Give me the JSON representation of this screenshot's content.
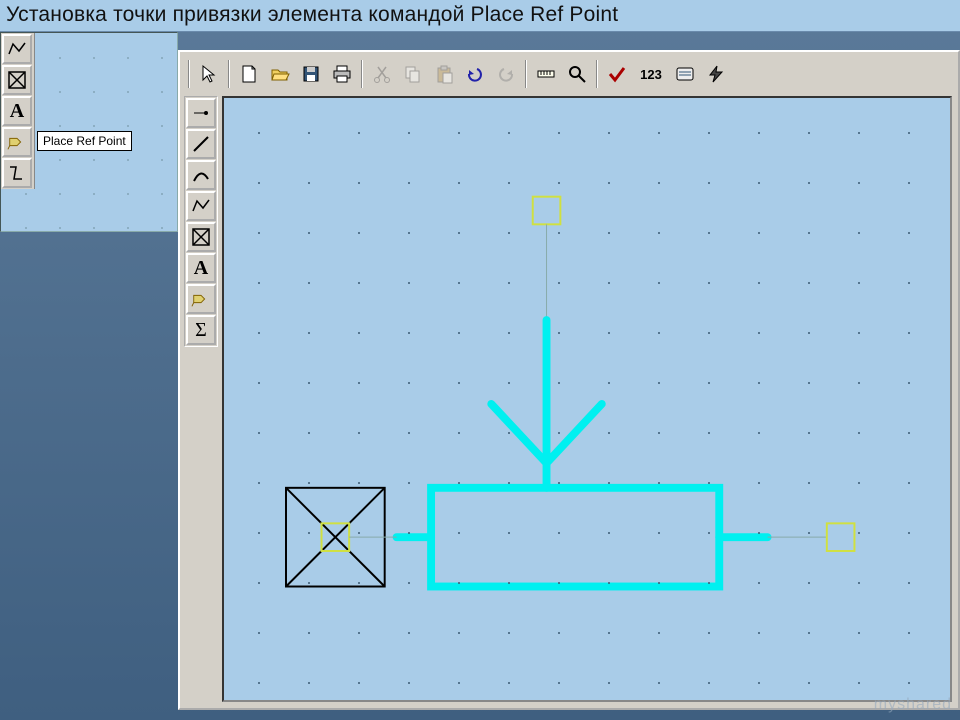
{
  "title": "Установка точки привязки элемента командой Place Ref Point",
  "tooltip": "Place Ref Point",
  "main_toolbar": {
    "select": "select-arrow",
    "new": "new-file",
    "open": "open-folder",
    "save": "save-disk",
    "print": "printer",
    "cut": "scissors",
    "copy": "copy",
    "paste": "clipboard",
    "undo": "undo",
    "redo": "redo",
    "measure": "ruler",
    "zoom": "magnify",
    "check": "check",
    "renumber": "123",
    "macro": "macro",
    "run": "lightning"
  },
  "left_toolbar": {
    "pin": "pin",
    "line": "line",
    "arc": "arc",
    "polygon": "polygon",
    "refpoint": "ref-point",
    "text": "A",
    "attribute": "tag",
    "sigma": "Σ"
  },
  "inset_toolbar": {
    "polygon": "polygon",
    "refpoint": "ref-point",
    "text": "A",
    "attribute": "tag",
    "break": "break"
  },
  "watermark": "myshared"
}
